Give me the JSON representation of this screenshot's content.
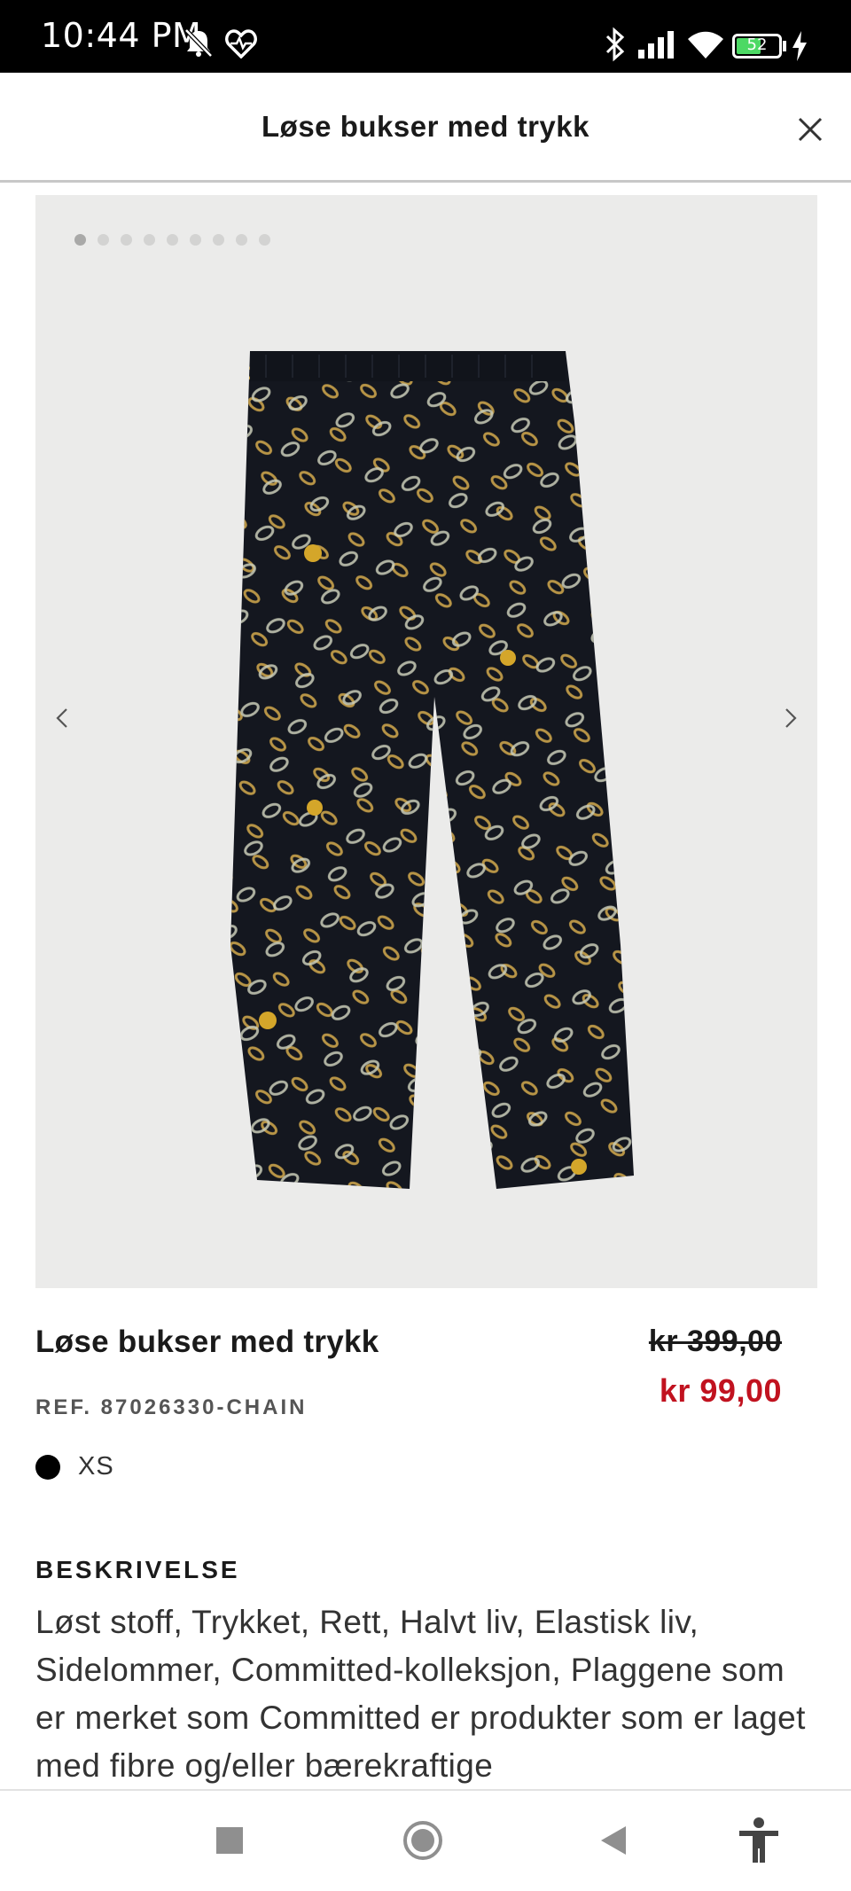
{
  "status_bar": {
    "time": "10:44 PM",
    "battery_level": "52",
    "icons": [
      "mute-bell-icon",
      "heart-pulse-icon",
      "bluetooth-icon",
      "signal-icon",
      "wifi-icon",
      "battery-icon",
      "charging-icon"
    ]
  },
  "header": {
    "title": "Løse bukser med trykk",
    "close_icon": "close-icon"
  },
  "gallery": {
    "image_count": 9,
    "active_index": 0,
    "prev_icon": "chevron-left-icon",
    "next_icon": "chevron-right-icon"
  },
  "product": {
    "name": "Løse bukser med trykk",
    "old_price": "kr 399,00",
    "new_price": "kr 99,00",
    "ref": "REF. 87026330-CHAIN",
    "color": "#000000",
    "size": "XS"
  },
  "description": {
    "heading": "BESKRIVELSE",
    "text": "Løst stoff, Trykket, Rett, Halvt liv, Elastisk liv, Sidelommer, Committed-kolleksjon, Plaggene som er merket som Committed er produkter som er laget med fibre og/eller bærekraftige"
  },
  "colors": {
    "sale_red": "#c1121f",
    "battery_green": "#4cd964",
    "image_bg": "#ebebea"
  },
  "navbar": {
    "icons": [
      "recents-square-icon",
      "home-circle-icon",
      "back-triangle-icon",
      "accessibility-icon"
    ]
  }
}
